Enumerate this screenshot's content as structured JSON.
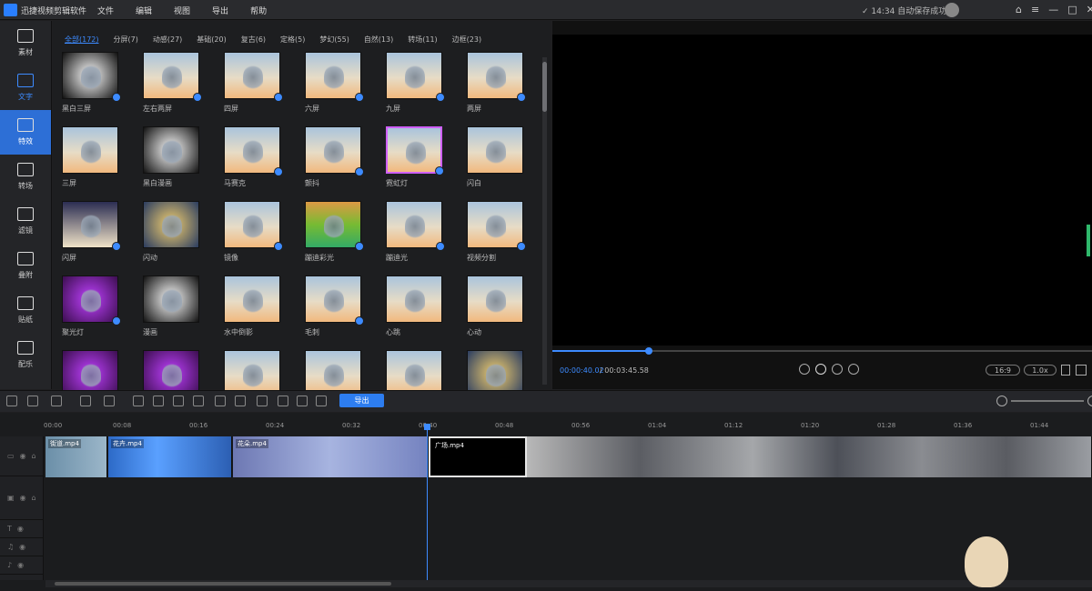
{
  "app": {
    "title": "迅捷视频剪辑软件",
    "menu": [
      "文件",
      "编辑",
      "视图",
      "导出",
      "帮助"
    ],
    "autosave": "✓ 14:34 自动保存成功",
    "window_buttons": [
      "⌂",
      "≡",
      "—",
      "□",
      "✕"
    ]
  },
  "sidebar": {
    "items": [
      {
        "label": "素材",
        "icon": "media-icon"
      },
      {
        "label": "文字",
        "icon": "text-icon"
      },
      {
        "label": "特效",
        "icon": "effects-icon"
      },
      {
        "label": "转场",
        "icon": "transition-icon"
      },
      {
        "label": "滤镜",
        "icon": "filter-icon"
      },
      {
        "label": "叠附",
        "icon": "overlay-icon"
      },
      {
        "label": "贴纸",
        "icon": "sticker-icon"
      },
      {
        "label": "配乐",
        "icon": "music-icon"
      }
    ]
  },
  "effects": {
    "tabs": [
      "全部(172)",
      "分屏(7)",
      "动感(27)",
      "基础(20)",
      "复古(6)",
      "定格(5)",
      "梦幻(55)",
      "自然(13)",
      "转场(11)",
      "边框(23)"
    ],
    "items": [
      "黑白三屏",
      "左右两屏",
      "四屏",
      "六屏",
      "九屏",
      "两屏",
      "三屏",
      "黑白漫画",
      "马赛克",
      "颤抖",
      "霓虹灯",
      "闪白",
      "闪屏",
      "闪动",
      "镜像",
      "蹦迪彩光",
      "蹦迪光",
      "视频分割",
      "聚光灯",
      "漫画",
      "水中倒影",
      "毛刺",
      "心跳",
      "心动",
      "",
      "",
      "",
      "",
      "",
      ""
    ]
  },
  "preview": {
    "current_time": "00:00:40.02",
    "total_time": "/ 00:03:45.58",
    "ratio": "16:9",
    "speed": "1.0x",
    "progress": 0.18
  },
  "toolbar": {
    "export_label": "导出"
  },
  "timeline": {
    "ruler": [
      "00:00",
      "00:08",
      "00:16",
      "00:24",
      "00:32",
      "00:40",
      "00:48",
      "00:56",
      "01:04",
      "01:12",
      "01:20",
      "01:28",
      "01:36",
      "01:44"
    ],
    "clips": [
      {
        "label": "街道.mp4"
      },
      {
        "label": "花卉.mp4"
      },
      {
        "label": "花朵.mp4"
      },
      {
        "label": "广场.mp4"
      },
      {
        "label": ""
      }
    ]
  }
}
